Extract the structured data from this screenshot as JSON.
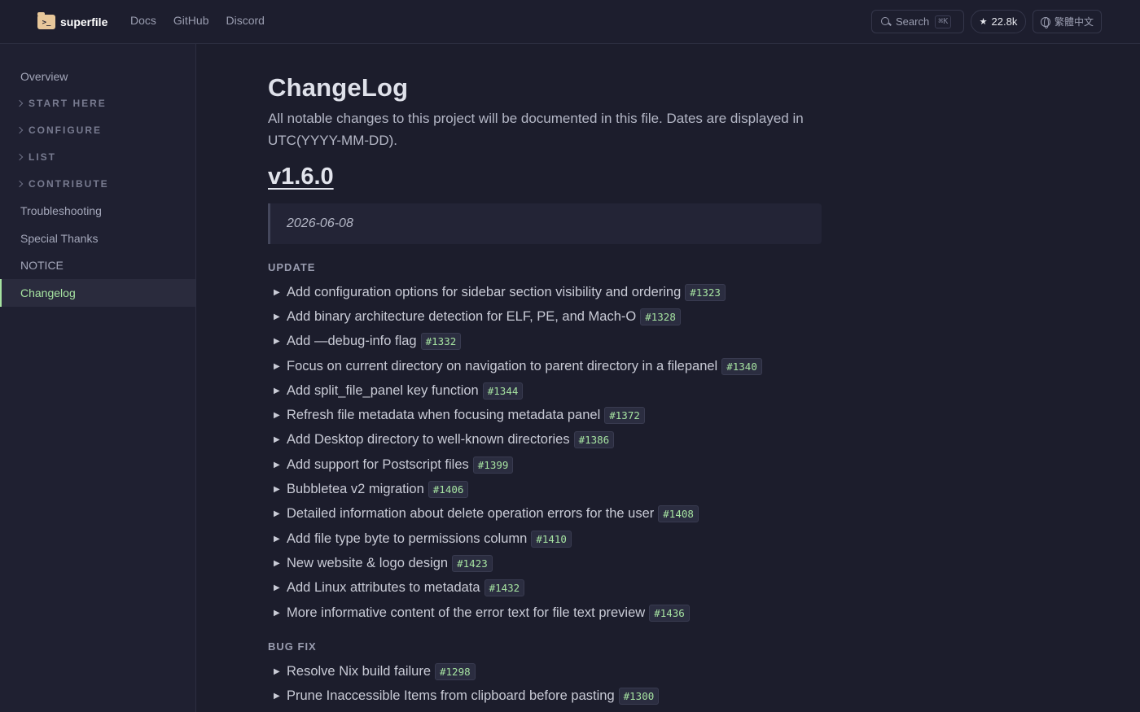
{
  "header": {
    "logo_text": "superfile",
    "logo_icon_glyph": ">_",
    "nav": [
      "Docs",
      "GitHub",
      "Discord"
    ],
    "search_label": "Search",
    "search_shortcut": "⌘K",
    "star_count": "22.8k",
    "language": "繁體中文"
  },
  "sidebar": {
    "overview": "Overview",
    "sections": [
      "START HERE",
      "CONFIGURE",
      "LIST",
      "CONTRIBUTE"
    ],
    "troubleshooting": "Troubleshooting",
    "special_thanks": "Special Thanks",
    "notice": "NOTICE",
    "changelog": "Changelog",
    "active": "Changelog"
  },
  "main": {
    "title": "ChangeLog",
    "intro": "All notable changes to this project will be documented in this file. Dates are displayed in UTC(YYYY-MM-DD).",
    "version": "v1.6.0",
    "date": "2026-06-08",
    "update_label": "UPDATE",
    "updates": [
      {
        "text": "Add configuration options for sidebar section visibility and ordering",
        "pr": "#1323"
      },
      {
        "text": "Add binary architecture detection for ELF, PE, and Mach-O",
        "pr": "#1328"
      },
      {
        "text": "Add —debug-info flag",
        "pr": "#1332"
      },
      {
        "text": "Focus on current directory on navigation to parent directory in a filepanel",
        "pr": "#1340"
      },
      {
        "text": "Add split_file_panel key function",
        "pr": "#1344"
      },
      {
        "text": "Refresh file metadata when focusing metadata panel",
        "pr": "#1372"
      },
      {
        "text": "Add Desktop directory to well-known directories",
        "pr": "#1386"
      },
      {
        "text": "Add support for Postscript files",
        "pr": "#1399"
      },
      {
        "text": "Bubbletea v2 migration",
        "pr": "#1406"
      },
      {
        "text": "Detailed information about delete operation errors for the user",
        "pr": "#1408"
      },
      {
        "text": "Add file type byte to permissions column",
        "pr": "#1410"
      },
      {
        "text": "New website & logo design",
        "pr": "#1423"
      },
      {
        "text": "Add Linux attributes to metadata",
        "pr": "#1432"
      },
      {
        "text": "More informative content of the error text for file text preview",
        "pr": "#1436"
      }
    ],
    "bugfix_label": "BUG FIX",
    "bugfixes": [
      {
        "text": "Resolve Nix build failure",
        "pr": "#1298"
      },
      {
        "text": "Prune Inaccessible Items from clipboard before pasting",
        "pr": "#1300"
      }
    ]
  },
  "colors": {
    "accent": "#a6e3a1",
    "background": "#1c1d2c",
    "sidebar_bg": "#1f2031"
  }
}
